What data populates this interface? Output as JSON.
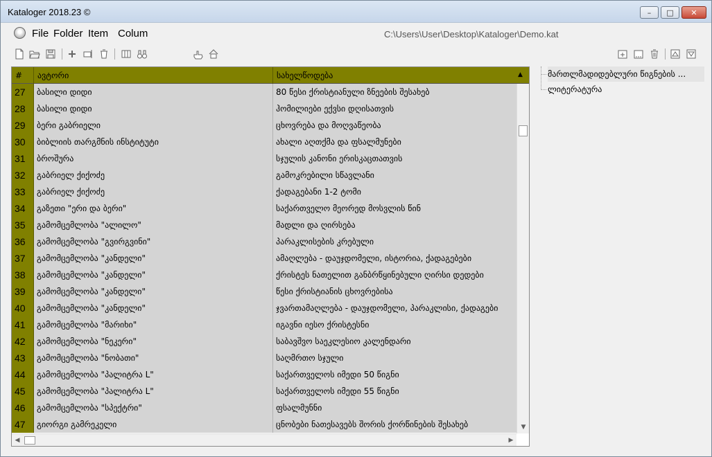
{
  "window": {
    "title": "Kataloger 2018.23 ©",
    "controls": {
      "minimize": "–",
      "maximize": "□",
      "close": "✕"
    }
  },
  "menu": {
    "items": [
      "File",
      "Folder",
      "Item",
      "Colum"
    ],
    "path": "C:\\Users\\User\\Desktop\\Kataloger\\Demo.kat"
  },
  "toolbar": {
    "icons": [
      "new-file-icon",
      "open-folder-icon",
      "save-icon",
      "add-icon",
      "edit-icon",
      "delete-icon",
      "columns-icon",
      "binoculars-icon",
      "hand-point-icon",
      "home-icon"
    ],
    "right_icons": [
      "add-folder-icon",
      "folder-dots-icon",
      "trash-icon",
      "move-up-icon",
      "move-down-icon"
    ]
  },
  "grid": {
    "columns": [
      "#",
      "ავტორი",
      "სახელწოდება"
    ],
    "selected_row": "44",
    "rows": [
      {
        "num": "27",
        "author": "ბასილი დიდი",
        "title": "80 წესი ქრისტიანული ზნეების შესახებ"
      },
      {
        "num": "28",
        "author": "ბასილი დიდი",
        "title": "ჰომილიები ექვსი დღისათვის"
      },
      {
        "num": "29",
        "author": "ბერი გაბრიელი",
        "title": "ცხოვრება და მოღვაწეობა"
      },
      {
        "num": "30",
        "author": "ბიბლიის თარგმნის ინსტიტუტი",
        "title": "ახალი აღთქმა და ფსალმუნები"
      },
      {
        "num": "31",
        "author": "ბროშურა",
        "title": "სჯულის კანონი ერისკაცთათვის"
      },
      {
        "num": "32",
        "author": "გაბრიელ ქიქოძე",
        "title": "გამოკრებილი სწავლანი"
      },
      {
        "num": "33",
        "author": "გაბრიელ ქიქოძე",
        "title": "ქადაგებანი 1-2 ტომი"
      },
      {
        "num": "34",
        "author": "გაზეთი \"ერი და ბერი\"",
        "title": "საქართველო მეორედ მოსვლის წინ"
      },
      {
        "num": "35",
        "author": "გამომცემლობა \"ალილო\"",
        "title": "მადლი და ღირსება"
      },
      {
        "num": "36",
        "author": "გამომცემლობა \"გვირგვინი\"",
        "title": "პარაკლისების კრებული"
      },
      {
        "num": "37",
        "author": "გამომცემლობა \"კანდელი\"",
        "title": "ამაღლება - დაუჯდომელი, ისტორია, ქადაგებები"
      },
      {
        "num": "38",
        "author": "გამომცემლობა \"კანდელი\"",
        "title": "ქრისტეს ნათელით განბრწყინებული ღირსი დედები"
      },
      {
        "num": "39",
        "author": "გამომცემლობა \"კანდელი\"",
        "title": "წესი ქრისტიანის ცხოვრებისა"
      },
      {
        "num": "40",
        "author": "გამომცემლობა \"კანდელი\"",
        "title": "ჯვართამაღლება - დაუჯდომელი, პარაკლისი, ქადაგები"
      },
      {
        "num": "41",
        "author": "გამომცემლობა \"მარიხი\"",
        "title": "იგავნი იესო ქრისტესნი"
      },
      {
        "num": "42",
        "author": "გამომცემლობა \"ნეკერი\"",
        "title": "საბავშვო საეკლესიო კალენდარი"
      },
      {
        "num": "43",
        "author": "გამომცემლობა \"ნობათი\"",
        "title": "საღმრთო სჯული"
      },
      {
        "num": "44",
        "author": "გამომცემლობა \"პალიტრა L\"",
        "title": "საქართველოს იმედი 50 წიგნი"
      },
      {
        "num": "45",
        "author": "გამომცემლობა \"პალიტრა L\"",
        "title": "საქართველოს იმედი 55 წიგნი"
      },
      {
        "num": "46",
        "author": "გამომცემლობა \"სპექტრი\"",
        "title": "ფსალმუნნი"
      },
      {
        "num": "47",
        "author": "გიორგი გამრეკელი",
        "title": "ცნობები ნათესავებს შორის ქორწინების შესახებ"
      }
    ]
  },
  "tree": {
    "items": [
      "მართლმადიდებლური წიგნების ...",
      "ლიტერატურა"
    ]
  },
  "colors": {
    "header_bg": "#808000",
    "row_bg": "#d4d4d4",
    "selected_outline": "#e00000"
  }
}
